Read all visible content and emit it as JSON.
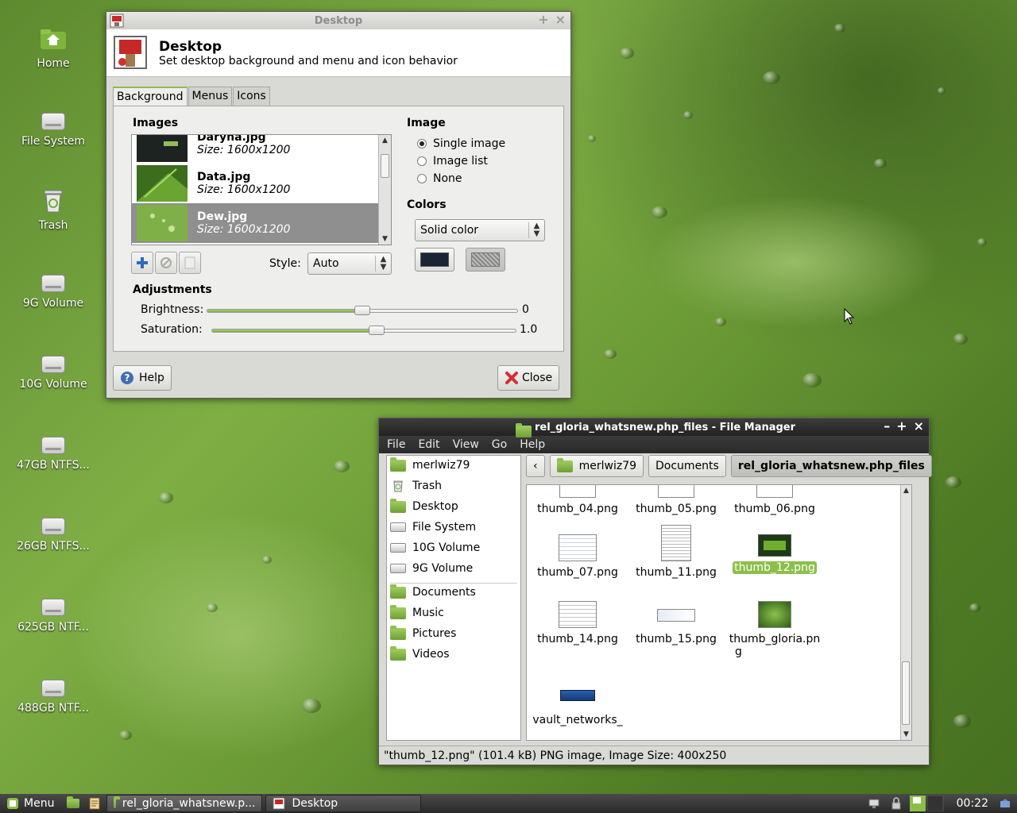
{
  "desktop_icons": [
    {
      "label": "Home",
      "icon": "home-folder-icon"
    },
    {
      "label": "File System",
      "icon": "drive-icon"
    },
    {
      "label": "Trash",
      "icon": "trash-icon"
    },
    {
      "label": "9G Volume",
      "icon": "drive-icon"
    },
    {
      "label": "10G Volume",
      "icon": "drive-icon"
    },
    {
      "label": "47GB NTFS...",
      "icon": "drive-icon"
    },
    {
      "label": "26GB NTFS...",
      "icon": "drive-icon"
    },
    {
      "label": "625GB NTF...",
      "icon": "drive-icon"
    },
    {
      "label": "488GB NTF...",
      "icon": "drive-icon"
    }
  ],
  "desktop_window": {
    "title": "Desktop",
    "header_title": "Desktop",
    "header_subtitle": "Set desktop background and menu and icon behavior",
    "tabs": [
      "Background",
      "Menus",
      "Icons"
    ],
    "images_label": "Images",
    "images": [
      {
        "name": "Daryna.jpg",
        "size": "Size: 1600x1200"
      },
      {
        "name": "Data.jpg",
        "size": "Size: 1600x1200"
      },
      {
        "name": "Dew.jpg",
        "size": "Size: 1600x1200"
      }
    ],
    "style_label": "Style:",
    "style_value": "Auto",
    "image_label": "Image",
    "image_options": [
      "Single image",
      "Image list",
      "None"
    ],
    "image_selected": "Single image",
    "colors_label": "Colors",
    "colors_value": "Solid color",
    "color1": "#1b2435",
    "adjustments_label": "Adjustments",
    "brightness_label": "Brightness:",
    "brightness_value": "0",
    "saturation_label": "Saturation:",
    "saturation_value": "1.0",
    "help_label": "Help",
    "close_label": "Close"
  },
  "file_manager": {
    "title": "rel_gloria_whatsnew.php_files - File Manager",
    "menu": [
      "File",
      "Edit",
      "View",
      "Go",
      "Help"
    ],
    "sidebar": [
      "merlwiz79",
      "Trash",
      "Desktop",
      "File System",
      "10G Volume",
      "9G Volume",
      "Documents",
      "Music",
      "Pictures",
      "Videos"
    ],
    "path": [
      "merlwiz79",
      "Documents",
      "rel_gloria_whatsnew.php_files"
    ],
    "files": [
      "thumb_04.png",
      "thumb_05.png",
      "thumb_06.png",
      "thumb_07.png",
      "thumb_11.png",
      "thumb_12.png",
      "thumb_14.png",
      "thumb_15.png",
      "thumb_gloria.pn",
      "vault_networks_"
    ],
    "file_wrap": {
      "thumb_gloria": "g"
    },
    "status": "\"thumb_12.png\" (101.4 kB) PNG image, Image Size: 400x250"
  },
  "taskbar": {
    "menu_label": "Menu",
    "tasks": [
      "rel_gloria_whatsnew.p...",
      "Desktop"
    ],
    "clock": "00:22"
  }
}
